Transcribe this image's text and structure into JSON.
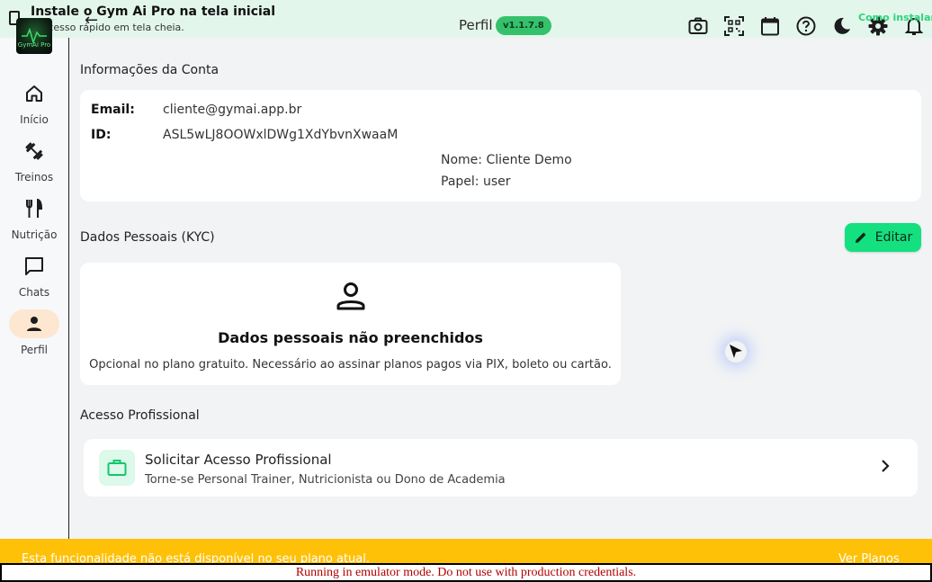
{
  "install_banner": {
    "title": "Instale o Gym Ai Pro na tela inicial",
    "subtitle": "Acesso rápido em tela cheia.",
    "how_to_install": "Como instalar",
    "logo_text": "GymAi Pro"
  },
  "header": {
    "title": "Perfil",
    "version": "v1.1.7.8"
  },
  "sidebar": {
    "items": [
      {
        "label": "Início",
        "icon": "home-icon"
      },
      {
        "label": "Treinos",
        "icon": "dumbbell-icon"
      },
      {
        "label": "Nutrição",
        "icon": "fork-knife-icon"
      },
      {
        "label": "Chats",
        "icon": "chat-icon"
      },
      {
        "label": "Perfil",
        "icon": "person-icon",
        "active": true
      }
    ]
  },
  "account": {
    "section_title": "Informações da Conta",
    "email_label": "Email:",
    "email_value": "cliente@gymai.app.br",
    "id_label": "ID:",
    "id_value": "ASL5wLJ8OOWxlDWg1XdYbvnXwaaM",
    "name_line": "Nome: Cliente Demo",
    "role_line": "Papel: user"
  },
  "kyc": {
    "section_title": "Dados Pessoais (KYC)",
    "edit_label": "Editar",
    "empty_title": "Dados pessoais não preenchidos",
    "empty_desc": "Opcional no plano gratuito. Necessário ao assinar planos pagos via PIX, boleto ou cartão."
  },
  "professional": {
    "section_title": "Acesso Profissional",
    "item_title": "Solicitar Acesso Profissional",
    "item_sub": "Torne-se Personal Trainer, Nutricionista ou Dono de Academia"
  },
  "plan_bar": {
    "text": "Esta funcionalidade não está disponível no seu plano atual.",
    "link": "Ver Planos"
  },
  "emulator_notice": "Running in emulator mode. Do not use with production credentials.",
  "colors": {
    "accent_green": "#14e07f",
    "plan_bar": "#ffc107",
    "active_nav": "#fde7d0"
  }
}
